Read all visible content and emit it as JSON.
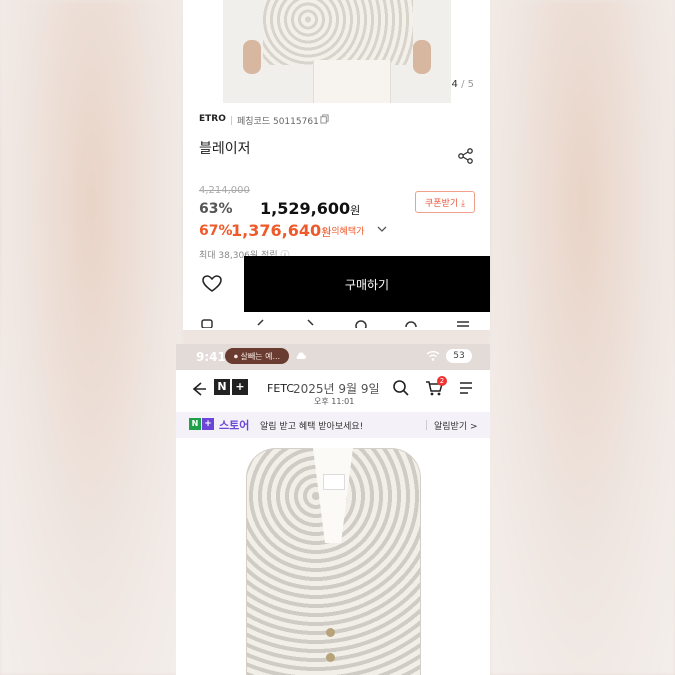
{
  "top_screen": {
    "page_indicator": {
      "current": "4",
      "total": "/ 5"
    },
    "brand": "ETRO",
    "product_code": "페칭코드 50115761",
    "product_name": "블레이저",
    "original_price": "4,214,000",
    "discount1": "63%",
    "price1": "1,529,600",
    "price1_unit": "원",
    "coupon_button": "쿠폰받기 ⤓",
    "discount2": "67%",
    "price2": "1,376,640",
    "price2_unit": "원",
    "my_benefit": "나의혜택가",
    "points_text": "최대 38,306원 적립 ⓘ",
    "buy_button": "구매하기"
  },
  "bottom_screen": {
    "status_time": "9:41",
    "live_pill": "⏺ 살빼는 예...",
    "battery": "53",
    "header_title": "FETC",
    "overlay_date": "2025년 9월 9일",
    "overlay_time": "오후 11:01",
    "cart_badge": "2",
    "promo_store": "스토어",
    "promo_text": "알림 받고 혜택 받아보세요!",
    "promo_action": "알림받기 >"
  },
  "colors": {
    "accent_orange": "#ef5a2b",
    "coupon_red": "#e8573b",
    "naver_green": "#1fa14a",
    "store_purple": "#6c46d6",
    "buy_black": "#000000"
  },
  "icons": [
    "copy-icon",
    "share-icon",
    "chevron-down-icon",
    "heart-icon",
    "back-icon",
    "search-icon",
    "cart-icon",
    "menu-icon",
    "wifi-icon",
    "cloud-icon"
  ]
}
